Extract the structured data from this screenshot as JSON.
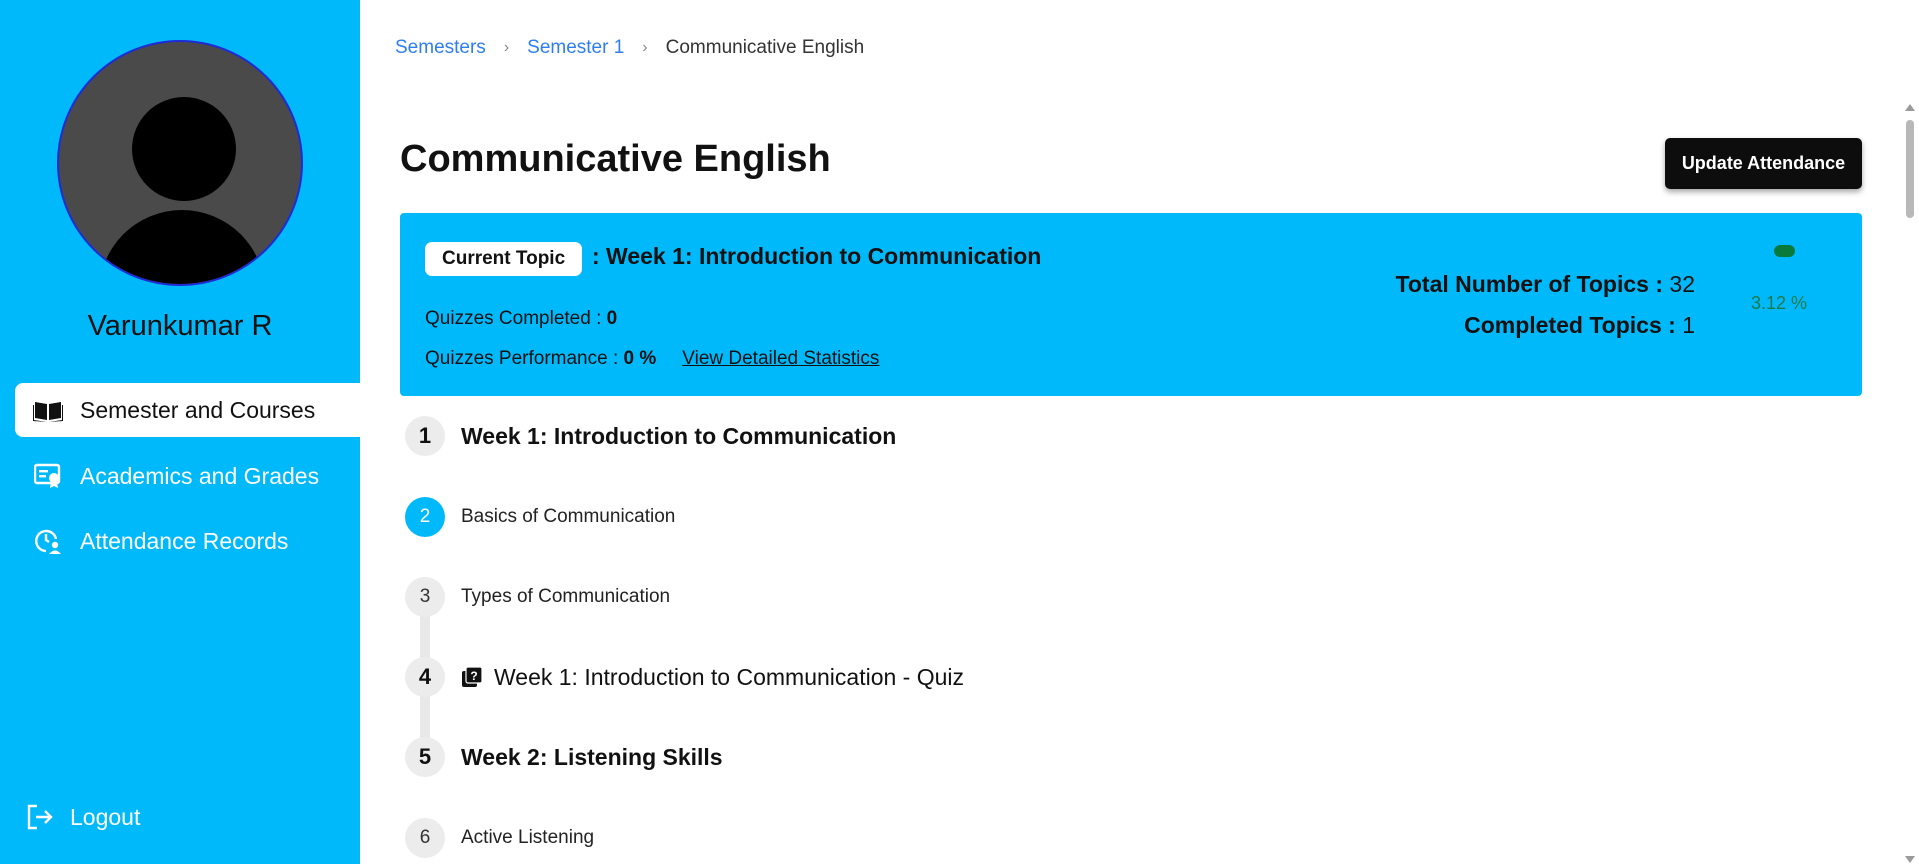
{
  "sidebar": {
    "user_name": "Varunkumar R",
    "nav": [
      {
        "label": "Semester and Courses",
        "icon": "book-open-icon",
        "active": true
      },
      {
        "label": "Academics and Grades",
        "icon": "certificate-icon",
        "active": false
      },
      {
        "label": "Attendance Records",
        "icon": "clock-user-icon",
        "active": false
      }
    ],
    "logout_label": "Logout"
  },
  "breadcrumb": {
    "items": [
      "Semesters",
      "Semester 1"
    ],
    "current": "Communicative English"
  },
  "page": {
    "title": "Communicative English",
    "update_button": "Update Attendance"
  },
  "current_topic": {
    "badge": "Current Topic",
    "title": ": Week 1: Introduction to Communication",
    "quizzes_completed_label": "Quizzes Completed : ",
    "quizzes_completed_value": "0",
    "quizzes_perf_label": "Quizzes Performance : ",
    "quizzes_perf_value": "0 %",
    "stats_link": "View Detailed Statistics",
    "total_topics_label": "Total Number of Topics : ",
    "total_topics_value": "32",
    "completed_topics_label": "Completed Topics : ",
    "completed_topics_value": "1",
    "progress_pct": "3.12 %",
    "progress_fraction": 0.0312,
    "progress_color": "#0a7a3a"
  },
  "topics": [
    {
      "num": "1",
      "label": "Week 1: Introduction to Communication",
      "type": "heading"
    },
    {
      "num": "2",
      "label": "Basics of Communication",
      "type": "topic",
      "active": true
    },
    {
      "num": "3",
      "label": "Types of Communication",
      "type": "topic"
    },
    {
      "num": "4",
      "label": "Week 1: Introduction to Communication - Quiz",
      "type": "quiz"
    },
    {
      "num": "5",
      "label": "Week 2: Listening Skills",
      "type": "heading"
    },
    {
      "num": "6",
      "label": "Active Listening",
      "type": "topic"
    }
  ],
  "colors": {
    "accent": "#00b9fb",
    "link": "#2f7ef0",
    "button": "#0d0d0d"
  }
}
